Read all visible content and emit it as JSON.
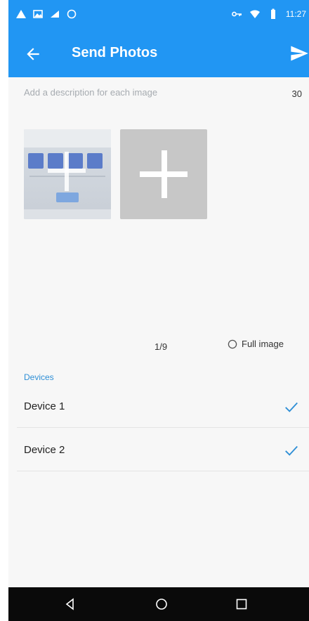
{
  "status_bar": {
    "time": "11:27",
    "icons": [
      "warning-icon",
      "image-icon",
      "signal-check-icon",
      "circle-icon",
      "vpn-key-icon",
      "wifi-icon",
      "battery-icon"
    ]
  },
  "app_bar": {
    "title": "Send Photos",
    "back_icon": "arrow-back-icon",
    "send_icon": "send-icon"
  },
  "description": {
    "placeholder": "Add a description for each image",
    "value": "",
    "char_count": "30"
  },
  "photos": {
    "count_label": "1/9",
    "add_icon": "plus-icon",
    "full_image_label": "Full image",
    "full_image_selected": false
  },
  "devices": {
    "header": "Devices",
    "items": [
      {
        "label": "Device 1",
        "checked": true
      },
      {
        "label": "Device 2",
        "checked": true
      }
    ]
  },
  "nav_bar": {
    "icons": [
      "nav-back-icon",
      "nav-home-icon",
      "nav-recents-icon"
    ]
  },
  "colors": {
    "primary": "#2196f3",
    "accent": "#2f8fd6",
    "check": "#2f8fd6",
    "add_tile": "#c7c7c7",
    "background": "#f7f7f7",
    "nav_bar": "#0a0a0a"
  }
}
